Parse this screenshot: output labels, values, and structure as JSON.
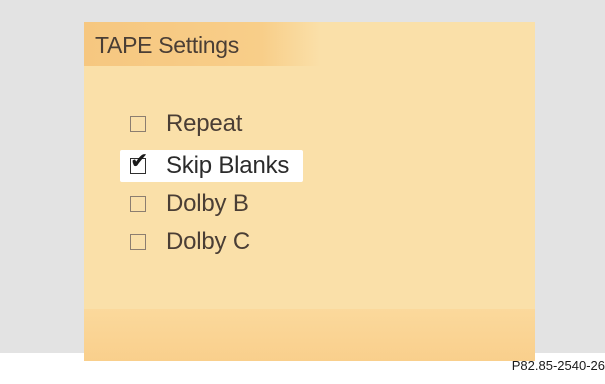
{
  "header": {
    "title": "TAPE Settings"
  },
  "options": [
    {
      "label": "Repeat",
      "checked": false,
      "selected": false
    },
    {
      "label": "Skip Blanks",
      "checked": true,
      "selected": true
    },
    {
      "label": "Dolby B",
      "checked": false,
      "selected": false
    },
    {
      "label": "Dolby C",
      "checked": false,
      "selected": false
    }
  ],
  "reference_code": "P82.85-2540-26",
  "colors": {
    "screen_background": "#fae0a9",
    "header_background": "#f6c780",
    "selection_highlight": "#ffffff",
    "text": "#4a3e35"
  }
}
